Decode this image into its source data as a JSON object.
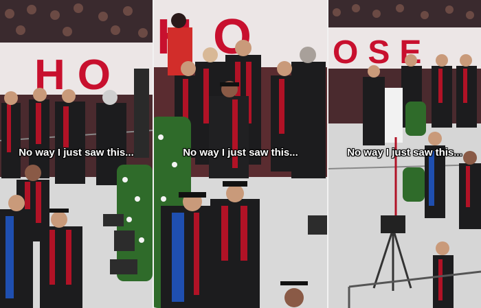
{
  "captions": {
    "left": "No way I just saw this...",
    "middle": "No way I just saw this...",
    "right": "No way I just saw this..."
  },
  "banners": {
    "left": "HO",
    "middle": "HO",
    "right": "OSE"
  },
  "colors": {
    "banner_red": "#c8102e",
    "banner_bg": "#ece6e6",
    "stage_floor": "#d8d8d8",
    "gown": "#1c1c1e",
    "stole": "#b11226",
    "crowd": "#3a2a2e",
    "flowers": "#2f6b2a"
  }
}
